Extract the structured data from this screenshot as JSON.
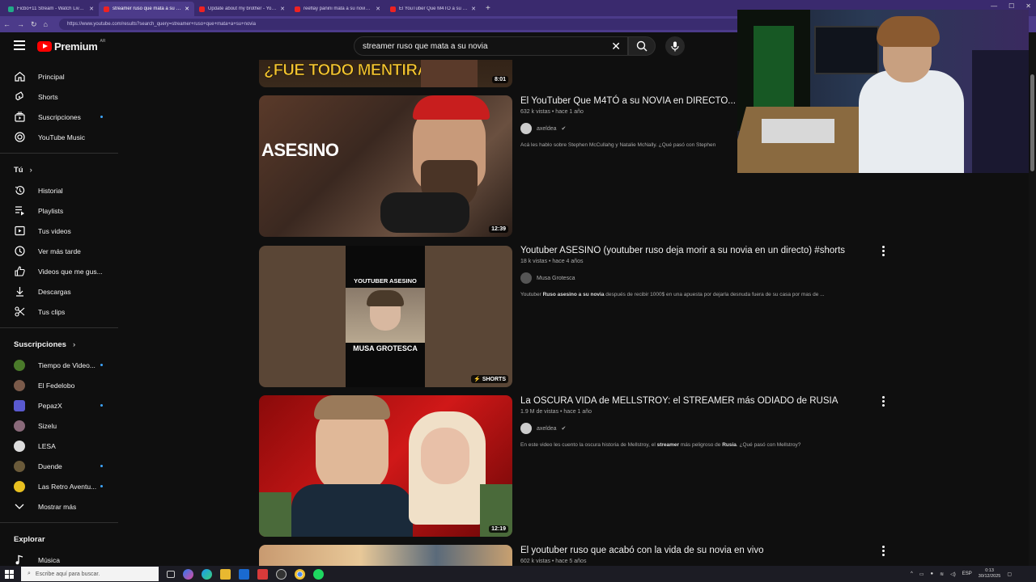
{
  "browser": {
    "tabs": [
      {
        "title": "Ficbo+11 Stream - Watch Live on",
        "active": false,
        "favicon": "kick-icon"
      },
      {
        "title": "streamer ruso que mata a su novi",
        "active": true,
        "favicon": "youtube-icon"
      },
      {
        "title": "Update about my brother - YouTu",
        "active": false,
        "favicon": "youtube-icon"
      },
      {
        "title": "reeflay panini mata a su novia - Yo",
        "active": false,
        "favicon": "youtube-icon"
      },
      {
        "title": "El YouTuber Que M4TÓ a su NOVI",
        "active": false,
        "favicon": "youtube-icon"
      }
    ],
    "url": "https://www.youtube.com/results?search_query=streamer+ruso+que+mata+a+su+novia"
  },
  "header": {
    "logo_text": "Premium",
    "country": "AR",
    "search_value": "streamer ruso que mata a su novia"
  },
  "sidebar": {
    "main": [
      {
        "label": "Principal",
        "icon": "home-icon"
      },
      {
        "label": "Shorts",
        "icon": "shorts-icon"
      },
      {
        "label": "Suscripciones",
        "icon": "subscriptions-icon",
        "dot": true
      },
      {
        "label": "YouTube Music",
        "icon": "music-icon"
      }
    ],
    "you_title": "Tú",
    "you": [
      {
        "label": "Historial",
        "icon": "history-icon"
      },
      {
        "label": "Playlists",
        "icon": "playlists-icon"
      },
      {
        "label": "Tus videos",
        "icon": "your-videos-icon"
      },
      {
        "label": "Ver más tarde",
        "icon": "watch-later-icon"
      },
      {
        "label": "Videos que me gus...",
        "icon": "liked-icon"
      },
      {
        "label": "Descargas",
        "icon": "download-icon"
      },
      {
        "label": "Tus clips",
        "icon": "clips-icon"
      }
    ],
    "subs_title": "Suscripciones",
    "subs": [
      {
        "label": "Tiempo de Video...",
        "color": "#4a7a2a",
        "dot": true
      },
      {
        "label": "El Fedelobo",
        "color": "#7a5a4a",
        "dot": false
      },
      {
        "label": "PepazX",
        "color": "#5a5ad0",
        "dot": true
      },
      {
        "label": "Sizelu",
        "color": "#8a6a7a",
        "dot": false
      },
      {
        "label": "LESA",
        "color": "#dddddd",
        "dot": false
      },
      {
        "label": "Duende",
        "color": "#6a5a3a",
        "dot": true
      },
      {
        "label": "Las Retro Aventu...",
        "color": "#e8c020",
        "dot": true
      }
    ],
    "show_more": "Mostrar más",
    "explore_title": "Explorar",
    "explore": [
      {
        "label": "Música",
        "icon": "music-note-icon"
      }
    ]
  },
  "results": [
    {
      "title": "",
      "thumb_text": "¿FUE TODO MENTIRA?",
      "duration": "8:01"
    },
    {
      "title": "El YouTuber Que M4TÓ a su NOVIA en DIRECTO...",
      "meta": "632 k vistas • hace 1 año",
      "channel": "axeldea",
      "verified": true,
      "description": "Acá les hablo sobre Stephen McCullahg y Natalie McNally. ¿Qué pasó con Stephen",
      "thumb_text": "ASESINO",
      "duration": "12:39"
    },
    {
      "title": "Youtuber ASESINO (youtuber ruso deja morir a su novia en un directo) #shorts",
      "meta": "18 k vistas • hace 4 años",
      "channel": "Musa Grotesca",
      "verified": false,
      "description_pre": "Youtuber ",
      "description_bold": "Ruso asesino a su novia",
      "description_post": " después de recibir 1000$ en una apuesta por dejarla desnuda fuera de su casa por mas de ...",
      "thumb_top": "YOUTUBER ASESINO",
      "thumb_bottom": "MUSA GROTESCA",
      "duration": "SHORTS"
    },
    {
      "title": "La OSCURA VIDA de MELLSTROY: el STREAMER más ODIADO de RUSIA",
      "meta": "1.9 M de vistas • hace 1 año",
      "channel": "axeldea",
      "verified": true,
      "description_pre": "En este video les cuento la oscura historia de Mellstroy, el ",
      "description_bold": "streamer",
      "description_mid": " más peligroso de ",
      "description_bold2": "Rusia",
      "description_post": ". ¿Qué pasó con Mellstroy?",
      "duration": "12:19"
    },
    {
      "title": "El youtuber ruso que acabó con la vida de su novia en vivo",
      "meta": "602 k vistas • hace 5 años"
    }
  ],
  "taskbar": {
    "search_placeholder": "Escribe aquí para buscar.",
    "lang": "ESP",
    "time": "0:13",
    "date": "30/12/2025"
  }
}
